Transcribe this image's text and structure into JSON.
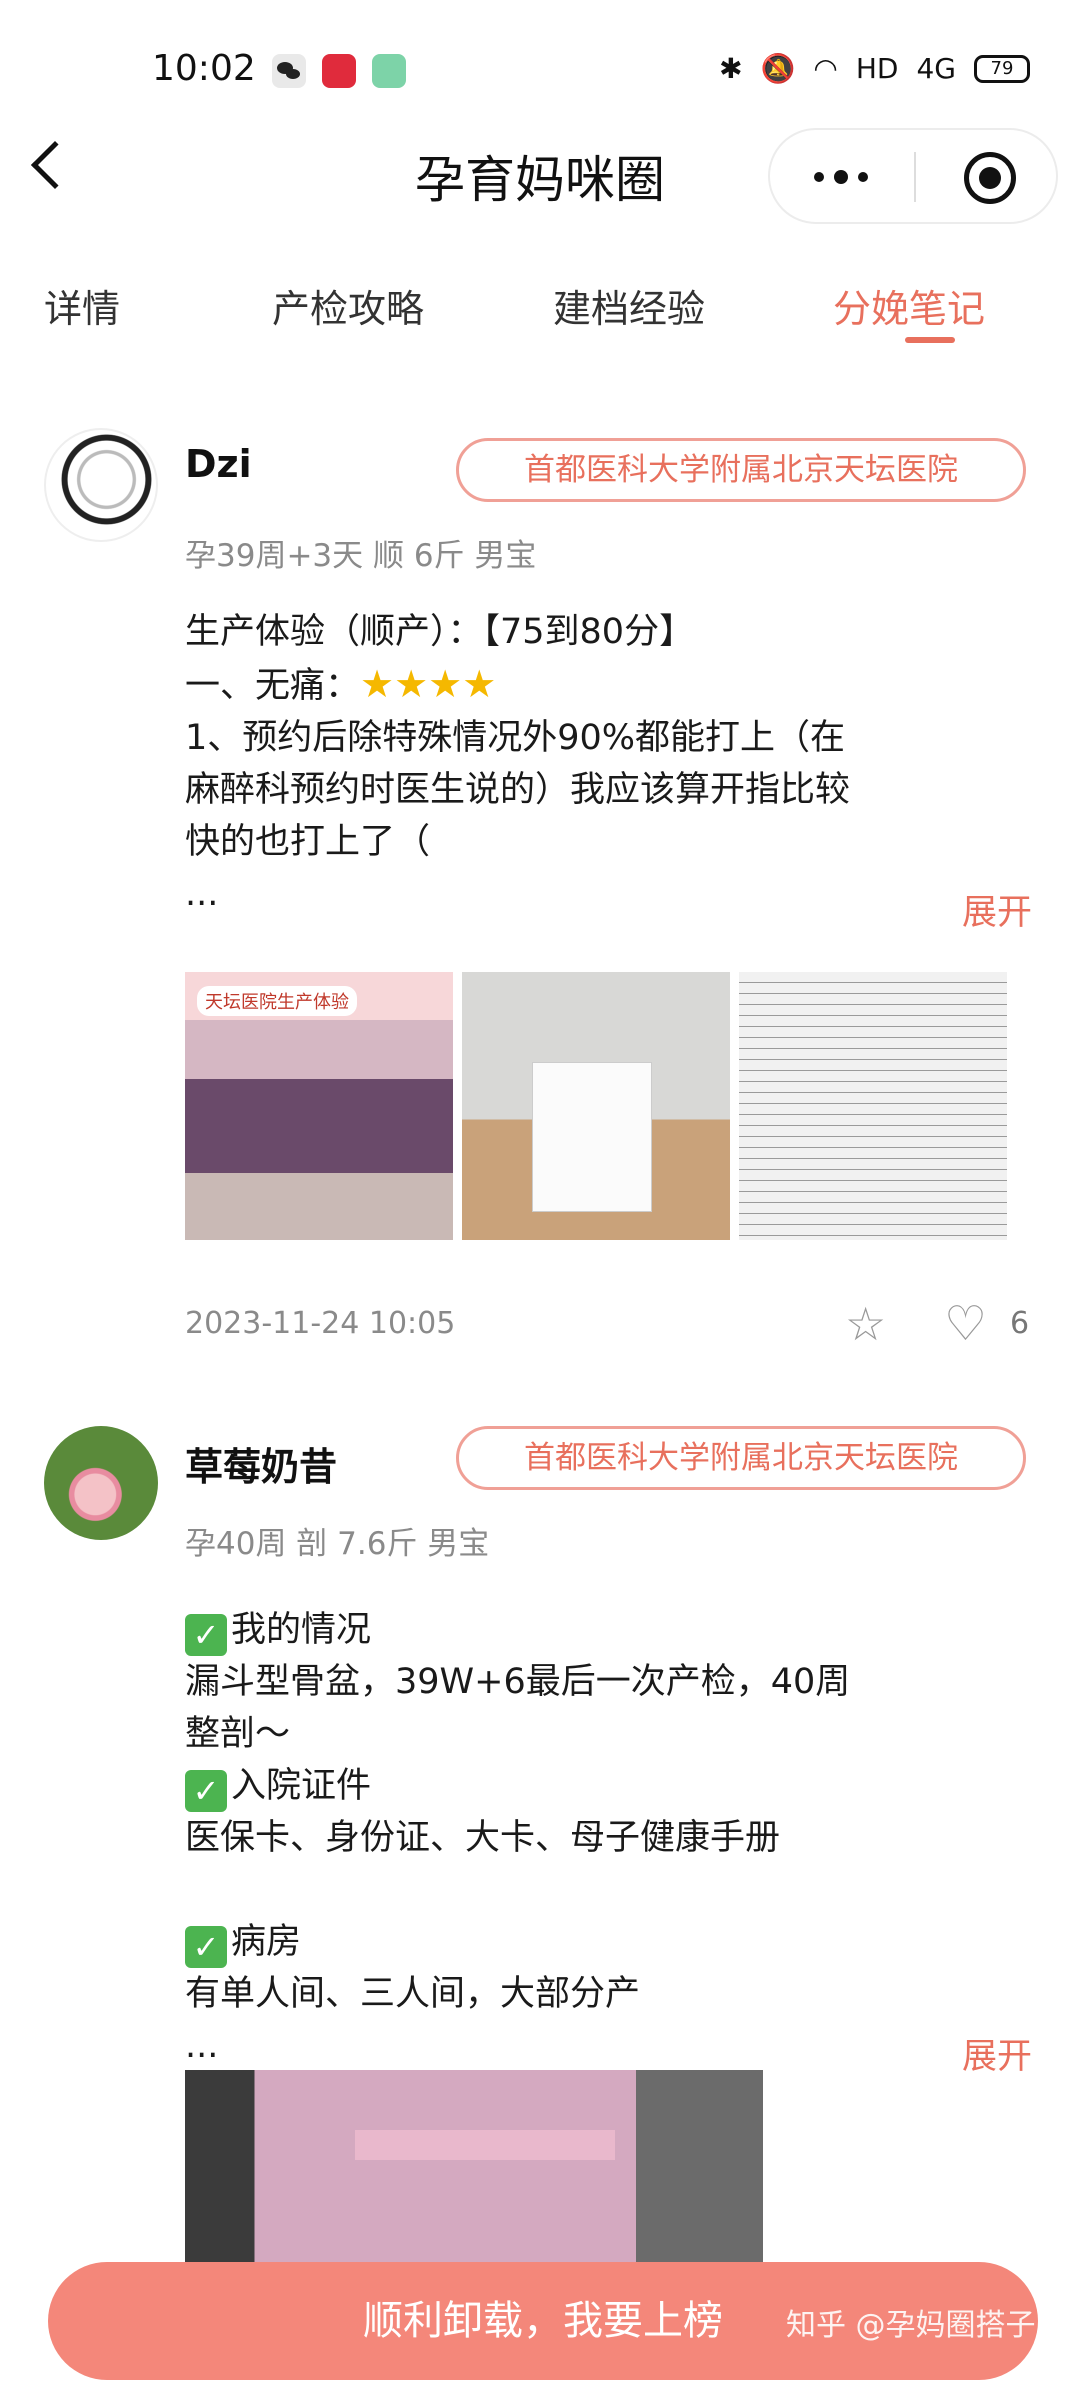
{
  "status_bar": {
    "time": "10:02",
    "network": "HD",
    "signal": "4G",
    "battery": "79"
  },
  "nav": {
    "title": "孕育妈咪圈"
  },
  "tabs": [
    {
      "label": "详情",
      "active": false
    },
    {
      "label": "产检攻略",
      "active": false
    },
    {
      "label": "建档经验",
      "active": false
    },
    {
      "label": "分娩笔记",
      "active": true
    }
  ],
  "posts": [
    {
      "username": "Dzi",
      "hospital": "首都医科大学附属北京天坛医院",
      "meta": "孕39周+3天 顺 6斤 男宝",
      "lines": [
        "生产体验（顺产）：【75到80分】",
        "一、无痛：",
        "1、预约后除特殊情况外90%都能打上（在",
        "麻醉科预约时医生说的）我应该算开指比较",
        "快的也打上了（",
        "..."
      ],
      "stars": "★★★★",
      "expand": "展开",
      "photo_label": "天坛医院生产体验",
      "timestamp": "2023-11-24 10:05",
      "likes": "6"
    },
    {
      "username": "草莓奶昔",
      "hospital": "首都医科大学附属北京天坛医院",
      "meta": "孕40周 剖 7.6斤 男宝",
      "lines": [
        "我的情况",
        "漏斗型骨盆，39W+6最后一次产检，40周",
        "整剖～",
        "入院证件",
        "医保卡、身份证、大卡、母子健康手册",
        "",
        "病房",
        "有单人间、三人间，大部分产",
        "..."
      ],
      "expand": "展开"
    }
  ],
  "cta": {
    "label": "顺利卸载，我要上榜"
  },
  "credit": "知乎 @孕妈圈搭子",
  "colors": {
    "accent": "#e8705d",
    "cta_bg": "#f4877a"
  }
}
